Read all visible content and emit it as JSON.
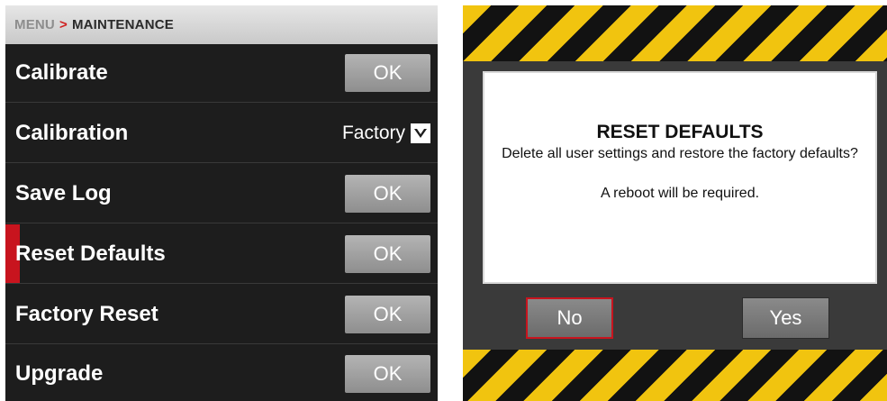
{
  "menu": {
    "breadcrumb": {
      "root": "MENU",
      "separator": ">",
      "current": "MAINTENANCE"
    },
    "rows": [
      {
        "label": "Calibrate",
        "control": "button",
        "button_label": "OK"
      },
      {
        "label": "Calibration",
        "control": "select",
        "value": "Factory"
      },
      {
        "label": "Save Log",
        "control": "button",
        "button_label": "OK"
      },
      {
        "label": "Reset Defaults",
        "control": "button",
        "button_label": "OK",
        "selected": true
      },
      {
        "label": "Factory Reset",
        "control": "button",
        "button_label": "OK"
      },
      {
        "label": "Upgrade",
        "control": "button",
        "button_label": "OK"
      }
    ],
    "selection_color": "#c8141e"
  },
  "dialog": {
    "title": "RESET DEFAULTS",
    "message": "Delete all user settings and restore the factory defaults?",
    "note": "A reboot will be required.",
    "no_label": "No",
    "yes_label": "Yes",
    "focused_button": "No",
    "hazard_colors": [
      "#f1c40f",
      "#121212"
    ]
  }
}
